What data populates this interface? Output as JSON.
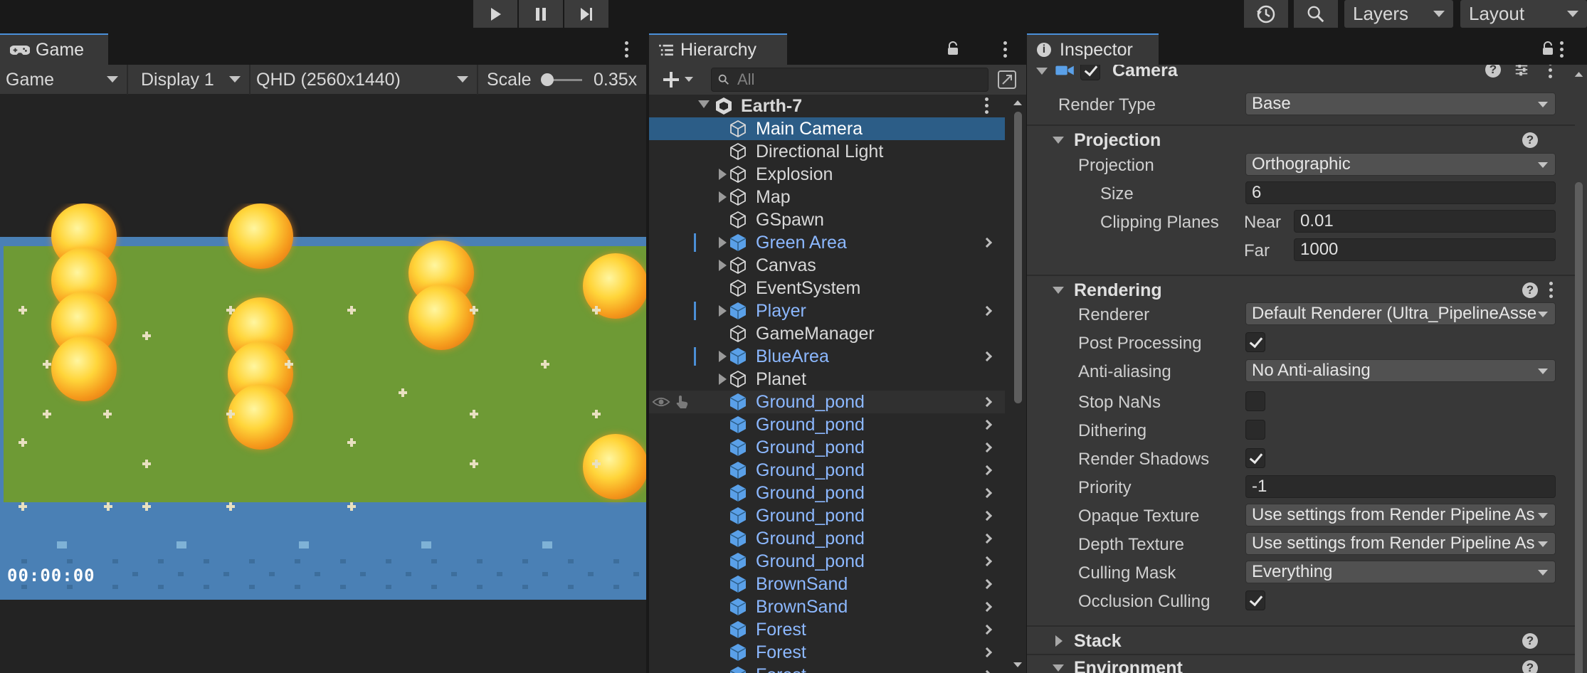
{
  "toolbar": {
    "play_icon": "play-icon",
    "pause_icon": "pause-icon",
    "step_icon": "step-icon",
    "history_icon": "history-icon",
    "search_icon": "search-icon",
    "layers_label": "Layers",
    "layout_label": "Layout"
  },
  "game": {
    "tab_label": "Game",
    "mode_label": "Game",
    "display_label": "Display 1",
    "resolution_label": "QHD (2560x1440)",
    "scale_label": "Scale",
    "scale_value": "0.35x",
    "scale_fraction": 0.0,
    "timer_text": "00:00:00"
  },
  "hierarchy": {
    "tab_label": "Hierarchy",
    "search_placeholder": "All",
    "root": "Earth-7",
    "items": [
      {
        "label": "Main Camera",
        "expandable": false,
        "prefab": false,
        "selected": true
      },
      {
        "label": "Directional Light",
        "expandable": false,
        "prefab": false
      },
      {
        "label": "Explosion",
        "expandable": true,
        "prefab": false
      },
      {
        "label": "Map",
        "expandable": true,
        "prefab": false
      },
      {
        "label": "GSpawn",
        "expandable": false,
        "prefab": false
      },
      {
        "label": "Green Area",
        "expandable": true,
        "prefab": true,
        "overridden": true
      },
      {
        "label": "Canvas",
        "expandable": true,
        "prefab": false
      },
      {
        "label": "EventSystem",
        "expandable": false,
        "prefab": false
      },
      {
        "label": "Player",
        "expandable": true,
        "prefab": true,
        "overridden": true
      },
      {
        "label": "GameManager",
        "expandable": false,
        "prefab": false
      },
      {
        "label": "BlueArea",
        "expandable": true,
        "prefab": true,
        "overridden": true
      },
      {
        "label": "Planet",
        "expandable": true,
        "prefab": false
      },
      {
        "label": "Ground_pond",
        "expandable": false,
        "prefab": true,
        "hover": true
      },
      {
        "label": "Ground_pond",
        "expandable": false,
        "prefab": true
      },
      {
        "label": "Ground_pond",
        "expandable": false,
        "prefab": true
      },
      {
        "label": "Ground_pond",
        "expandable": false,
        "prefab": true
      },
      {
        "label": "Ground_pond",
        "expandable": false,
        "prefab": true
      },
      {
        "label": "Ground_pond",
        "expandable": false,
        "prefab": true
      },
      {
        "label": "Ground_pond",
        "expandable": false,
        "prefab": true
      },
      {
        "label": "Ground_pond",
        "expandable": false,
        "prefab": true
      },
      {
        "label": "BrownSand",
        "expandable": false,
        "prefab": true
      },
      {
        "label": "BrownSand",
        "expandable": false,
        "prefab": true
      },
      {
        "label": "Forest",
        "expandable": false,
        "prefab": true
      },
      {
        "label": "Forest",
        "expandable": false,
        "prefab": true
      },
      {
        "label": "Forest",
        "expandable": false,
        "prefab": true
      }
    ]
  },
  "inspector": {
    "tab_label": "Inspector",
    "component_title": "Camera",
    "render_type": {
      "label": "Render Type",
      "value": "Base"
    },
    "projection_section": "Projection",
    "projection": {
      "label": "Projection",
      "value": "Orthographic"
    },
    "size": {
      "label": "Size",
      "value": "6"
    },
    "clipping": {
      "label": "Clipping Planes",
      "near_label": "Near",
      "near": "0.01",
      "far_label": "Far",
      "far": "1000"
    },
    "rendering_section": "Rendering",
    "renderer": {
      "label": "Renderer",
      "value": "Default Renderer (Ultra_PipelineAsse"
    },
    "post_processing": {
      "label": "Post Processing",
      "checked": true
    },
    "anti_aliasing": {
      "label": "Anti-aliasing",
      "value": "No Anti-aliasing"
    },
    "stop_nans": {
      "label": "Stop NaNs",
      "checked": false
    },
    "dithering": {
      "label": "Dithering",
      "checked": false
    },
    "render_shadows": {
      "label": "Render Shadows",
      "checked": true
    },
    "priority": {
      "label": "Priority",
      "value": "-1"
    },
    "opaque_texture": {
      "label": "Opaque Texture",
      "value": "Use settings from Render Pipeline As"
    },
    "depth_texture": {
      "label": "Depth Texture",
      "value": "Use settings from Render Pipeline As"
    },
    "culling_mask": {
      "label": "Culling Mask",
      "value": "Everything"
    },
    "occlusion_culling": {
      "label": "Occlusion Culling",
      "checked": true
    },
    "stack_section": "Stack",
    "environment_section": "Environment"
  }
}
